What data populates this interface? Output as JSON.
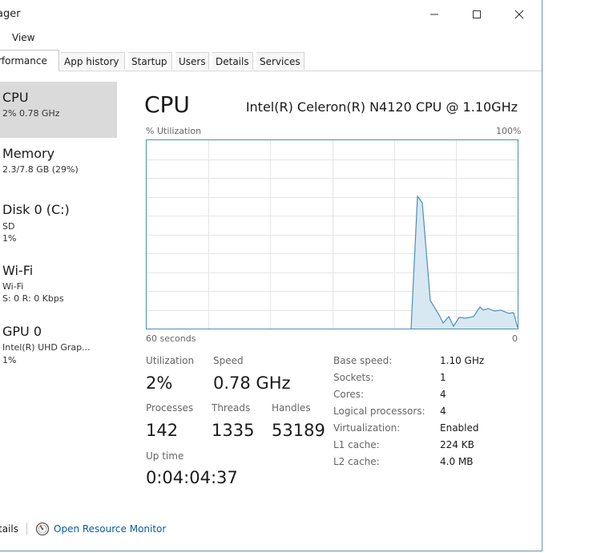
{
  "window": {
    "title": "ager",
    "controls": {
      "minimize_icon": "minimize-icon",
      "maximize_icon": "maximize-icon",
      "close_icon": "close-icon"
    }
  },
  "menu": [
    "View"
  ],
  "tabs": [
    {
      "label": "rformance",
      "active": true
    },
    {
      "label": "App history",
      "active": false
    },
    {
      "label": "Startup",
      "active": false
    },
    {
      "label": "Users",
      "active": false
    },
    {
      "label": "Details",
      "active": false
    },
    {
      "label": "Services",
      "active": false
    }
  ],
  "sidebar": [
    {
      "name": "CPU",
      "lines": [
        "2% 0.78 GHz"
      ],
      "selected": true
    },
    {
      "name": "Memory",
      "lines": [
        "2.3/7.8 GB (29%)"
      ],
      "selected": false
    },
    {
      "name": "Disk 0 (C:)",
      "lines": [
        "SD",
        "1%"
      ],
      "selected": false
    },
    {
      "name": "Wi-Fi",
      "lines": [
        "Wi-Fi",
        "S: 0 R: 0 Kbps"
      ],
      "selected": false
    },
    {
      "name": "GPU 0",
      "lines": [
        "Intel(R) UHD Grap...",
        "1%"
      ],
      "selected": false
    }
  ],
  "main": {
    "title": "CPU",
    "model": "Intel(R) Celeron(R) N4120 CPU @ 1.10GHz",
    "graph": {
      "y_label": "% Utilization",
      "y_max_label": "100%",
      "x_label": "60 seconds",
      "x_min_label": "0",
      "line_color": "#4a90b8",
      "fill_color": "#d8e8f2",
      "grid_color": "#e6e6e6"
    },
    "stats": {
      "utilization_label": "Utilization",
      "utilization_value": "2%",
      "speed_label": "Speed",
      "speed_value": "0.78 GHz",
      "processes_label": "Processes",
      "processes_value": "142",
      "threads_label": "Threads",
      "threads_value": "1335",
      "handles_label": "Handles",
      "handles_value": "53189",
      "uptime_label": "Up time",
      "uptime_value": "0:04:04:37"
    },
    "specs": [
      {
        "label": "Base speed:",
        "value": "1.10 GHz"
      },
      {
        "label": "Sockets:",
        "value": "1"
      },
      {
        "label": "Cores:",
        "value": "4"
      },
      {
        "label": "Logical processors:",
        "value": "4"
      },
      {
        "label": "Virtualization:",
        "value": "Enabled"
      },
      {
        "label": "L1 cache:",
        "value": "224 KB"
      },
      {
        "label": "L2 cache:",
        "value": "4.0 MB"
      }
    ]
  },
  "footer": {
    "details_label": "tails",
    "monitor_label": "Open Resource Monitor",
    "monitor_icon": "resource-monitor-icon"
  }
}
